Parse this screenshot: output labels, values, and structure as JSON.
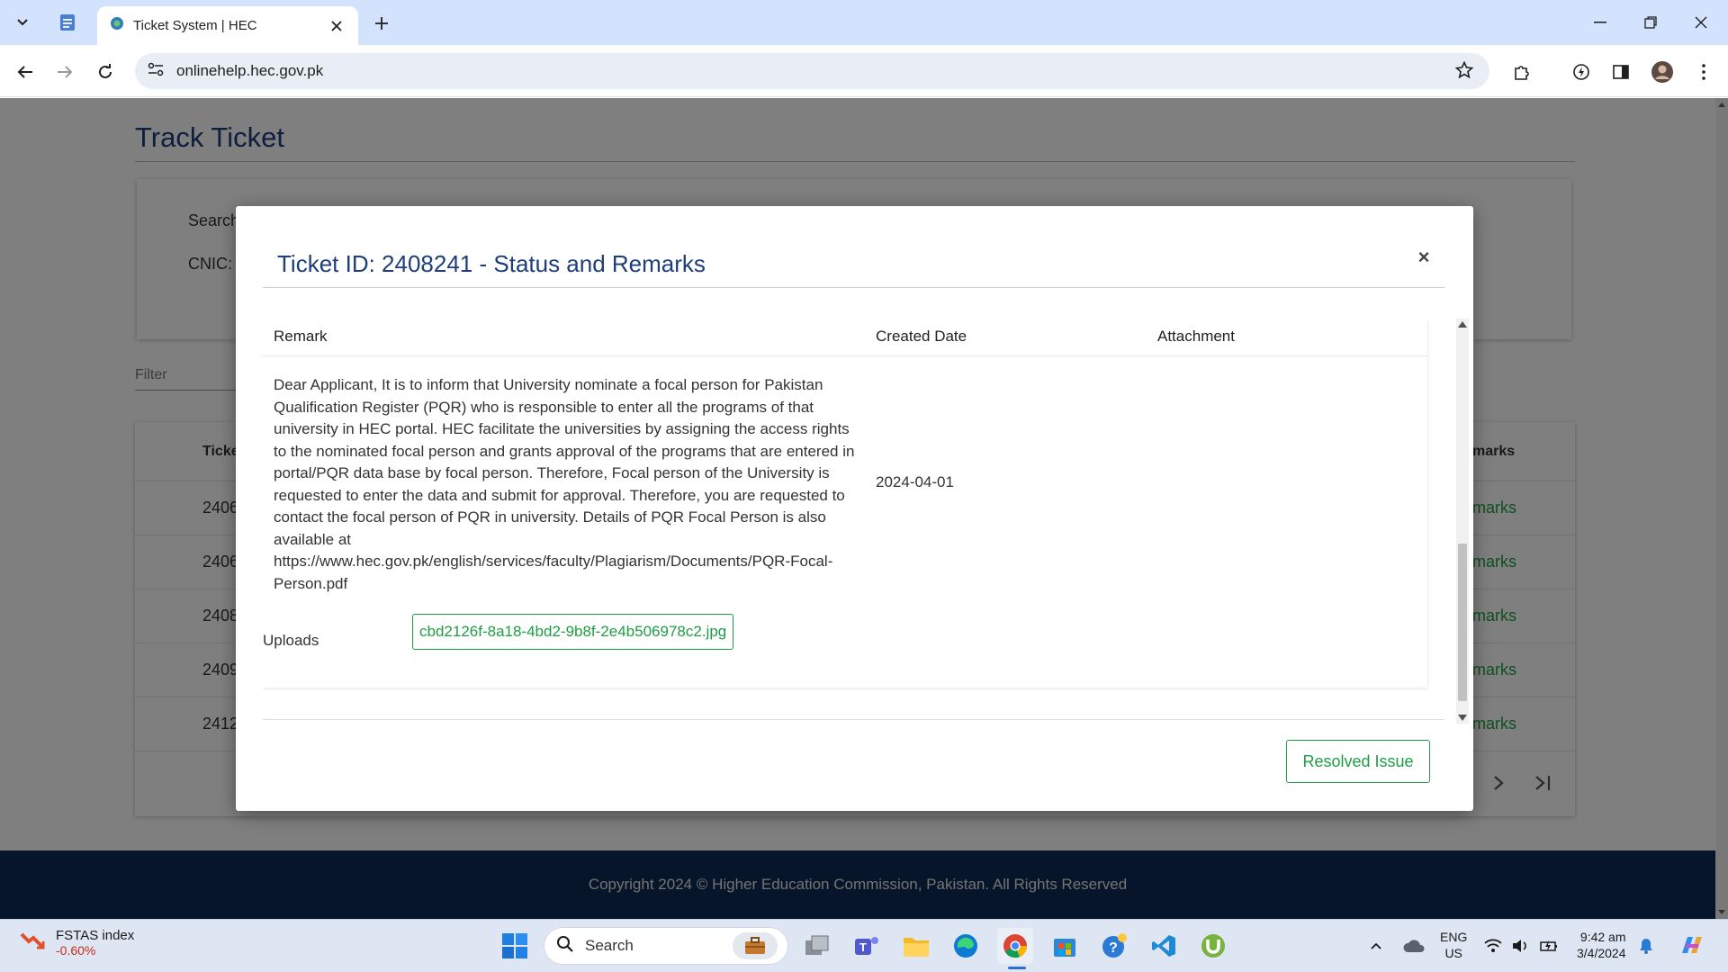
{
  "browser": {
    "tab_title": "Ticket System | HEC",
    "url": "onlinehelp.hec.gov.pk"
  },
  "page": {
    "title": "Track Ticket",
    "search_label": "Search",
    "cnic_label": "CNIC:",
    "filter_placeholder": "Filter",
    "tickets_header_id": "Ticket",
    "tickets_header_remarks": "marks",
    "tickets": [
      {
        "id": "2406",
        "remarks": "marks"
      },
      {
        "id": "2406",
        "remarks": "marks"
      },
      {
        "id": "2408",
        "remarks": "marks"
      },
      {
        "id": "2409",
        "remarks": "marks"
      },
      {
        "id": "2412",
        "remarks": "marks"
      }
    ],
    "footer": "Copyright 2024 © Higher Education Commission, Pakistan. All Rights Reserved"
  },
  "modal": {
    "title": "Ticket ID: 2408241 - Status and Remarks",
    "close_symbol": "×",
    "columns": [
      "Remark",
      "Created Date",
      "Attachment"
    ],
    "remark_text": "Dear Applicant, It is to inform that University nominate a focal person for Pakistan Qualification Register (PQR) who is responsible to enter all the programs of that university in HEC portal. HEC facilitate the universities by assigning the access rights to the nominated focal person and grants approval of the programs that are entered in portal/PQR data base by focal person. Therefore, Focal person of the University is requested to enter the data and submit for approval. Therefore, you are requested to contact the focal person of PQR in university. Details of PQR Focal Person is also available at https://www.hec.gov.pk/english/services/faculty/Plagiarism/Documents/PQR-Focal-Person.pdf",
    "created_date": "2024-04-01",
    "uploads_label": "Uploads",
    "upload_file": "cbd2126f-8a18-4bd2-9b8f-2e4b506978c2.jpg",
    "resolved_button": "Resolved Issue"
  },
  "taskbar": {
    "widget_title": "FSTAS index",
    "widget_value": "-0.60%",
    "search_label": "Search",
    "lang_top": "ENG",
    "lang_bottom": "US",
    "time": "9:42 am",
    "date": "3/4/2024"
  },
  "colors": {
    "accent_blue": "#1d3e7a",
    "accent_green": "#1e9e44",
    "footer_bg": "#0c2b52",
    "tabbar_bg": "#d3e3fd"
  }
}
